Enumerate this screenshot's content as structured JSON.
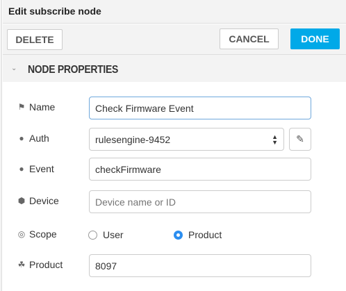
{
  "title": "Edit subscribe node",
  "toolbar": {
    "delete": "DELETE",
    "cancel": "CANCEL",
    "done": "DONE",
    "accent": "#00a9e8"
  },
  "section": {
    "title": "NODE PROPERTIES"
  },
  "fields": {
    "name": {
      "label": "Name",
      "value": "Check Firmware Event",
      "icon": "tag-icon"
    },
    "auth": {
      "label": "Auth",
      "value": "rulesengine-9452",
      "icon": "user-icon"
    },
    "event": {
      "label": "Event",
      "value": "checkFirmware",
      "icon": "comment-icon"
    },
    "device": {
      "label": "Device",
      "placeholder": "Device name or ID",
      "icon": "cube-icon"
    },
    "scope": {
      "label": "Scope",
      "options": [
        "User",
        "Product"
      ],
      "selected": "Product",
      "icon": "target-icon"
    },
    "product": {
      "label": "Product",
      "value": "8097",
      "icon": "cubes-icon"
    }
  }
}
